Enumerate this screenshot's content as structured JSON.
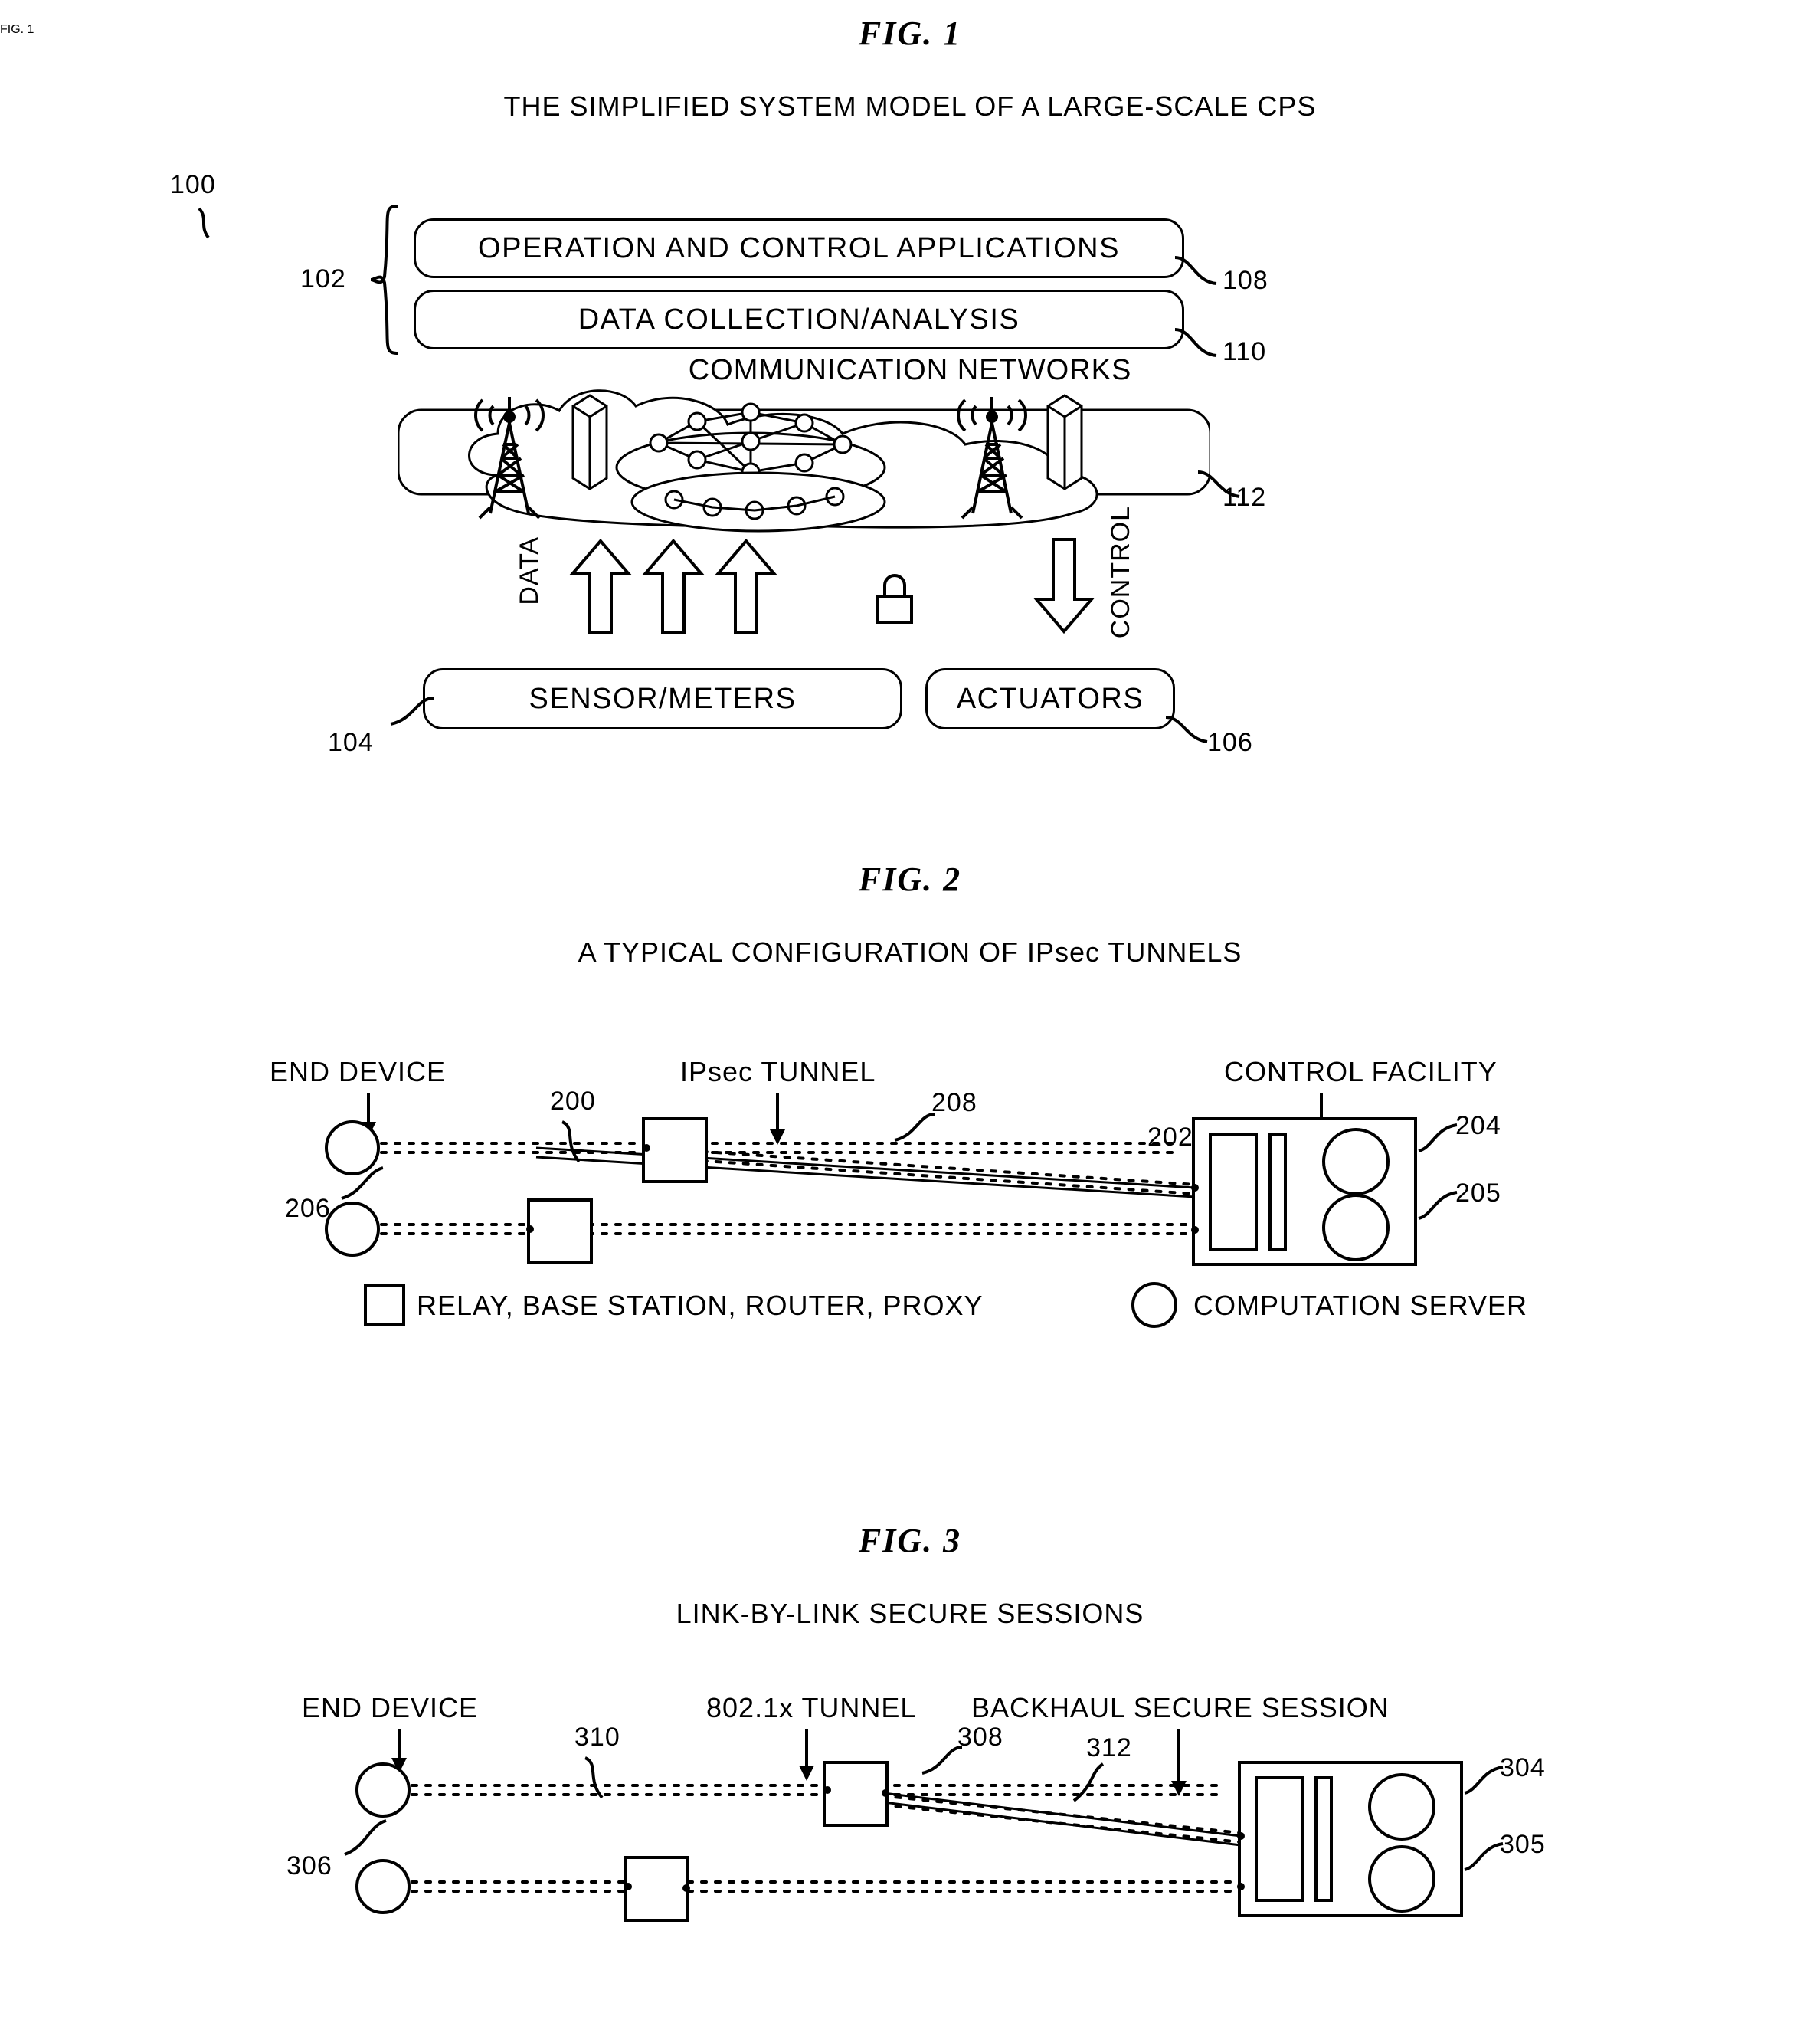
{
  "figures": [
    {
      "id": "fig1",
      "title": "FIG.   1",
      "subtitle": "THE SIMPLIFIED SYSTEM MODEL OF A LARGE-SCALE CPS",
      "labels": {
        "ref_100": "100",
        "ref_102": "102",
        "ref_104": "104",
        "ref_106": "106",
        "ref_108": "108",
        "ref_110": "110",
        "ref_112": "112",
        "box_operation": "OPERATION AND CONTROL APPLICATIONS",
        "box_data_collection": "DATA COLLECTION/ANALYSIS",
        "comm_networks": "COMMUNICATION NETWORKS",
        "data": "DATA",
        "control": "CONTROL",
        "box_sensors": "SENSOR/METERS",
        "box_actuators": "ACTUATORS"
      }
    },
    {
      "id": "fig2",
      "title": "FIG.   2",
      "subtitle": "A TYPICAL CONFIGURATION OF IPsec TUNNELS",
      "labels": {
        "end_device": "END DEVICE",
        "ipsec_tunnel": "IPsec TUNNEL",
        "control_facility": "CONTROL FACILITY",
        "ref_200": "200",
        "ref_202": "202",
        "ref_204": "204",
        "ref_205": "205",
        "ref_206": "206",
        "ref_208": "208",
        "legend_relay": "RELAY, BASE STATION, ROUTER, PROXY",
        "legend_server": "COMPUTATION SERVER"
      }
    },
    {
      "id": "fig3",
      "title": "FIG.   3",
      "subtitle": "LINK-BY-LINK SECURE SESSIONS",
      "labels": {
        "end_device": "END DEVICE",
        "tunnel_8021x": "802.1x TUNNEL",
        "backhaul": "BACKHAUL SECURE SESSION",
        "ref_304": "304",
        "ref_305": "305",
        "ref_306": "306",
        "ref_308": "308",
        "ref_310": "310",
        "ref_312": "312"
      }
    }
  ],
  "colors": {
    "stroke": "#000000",
    "background": "#ffffff"
  }
}
